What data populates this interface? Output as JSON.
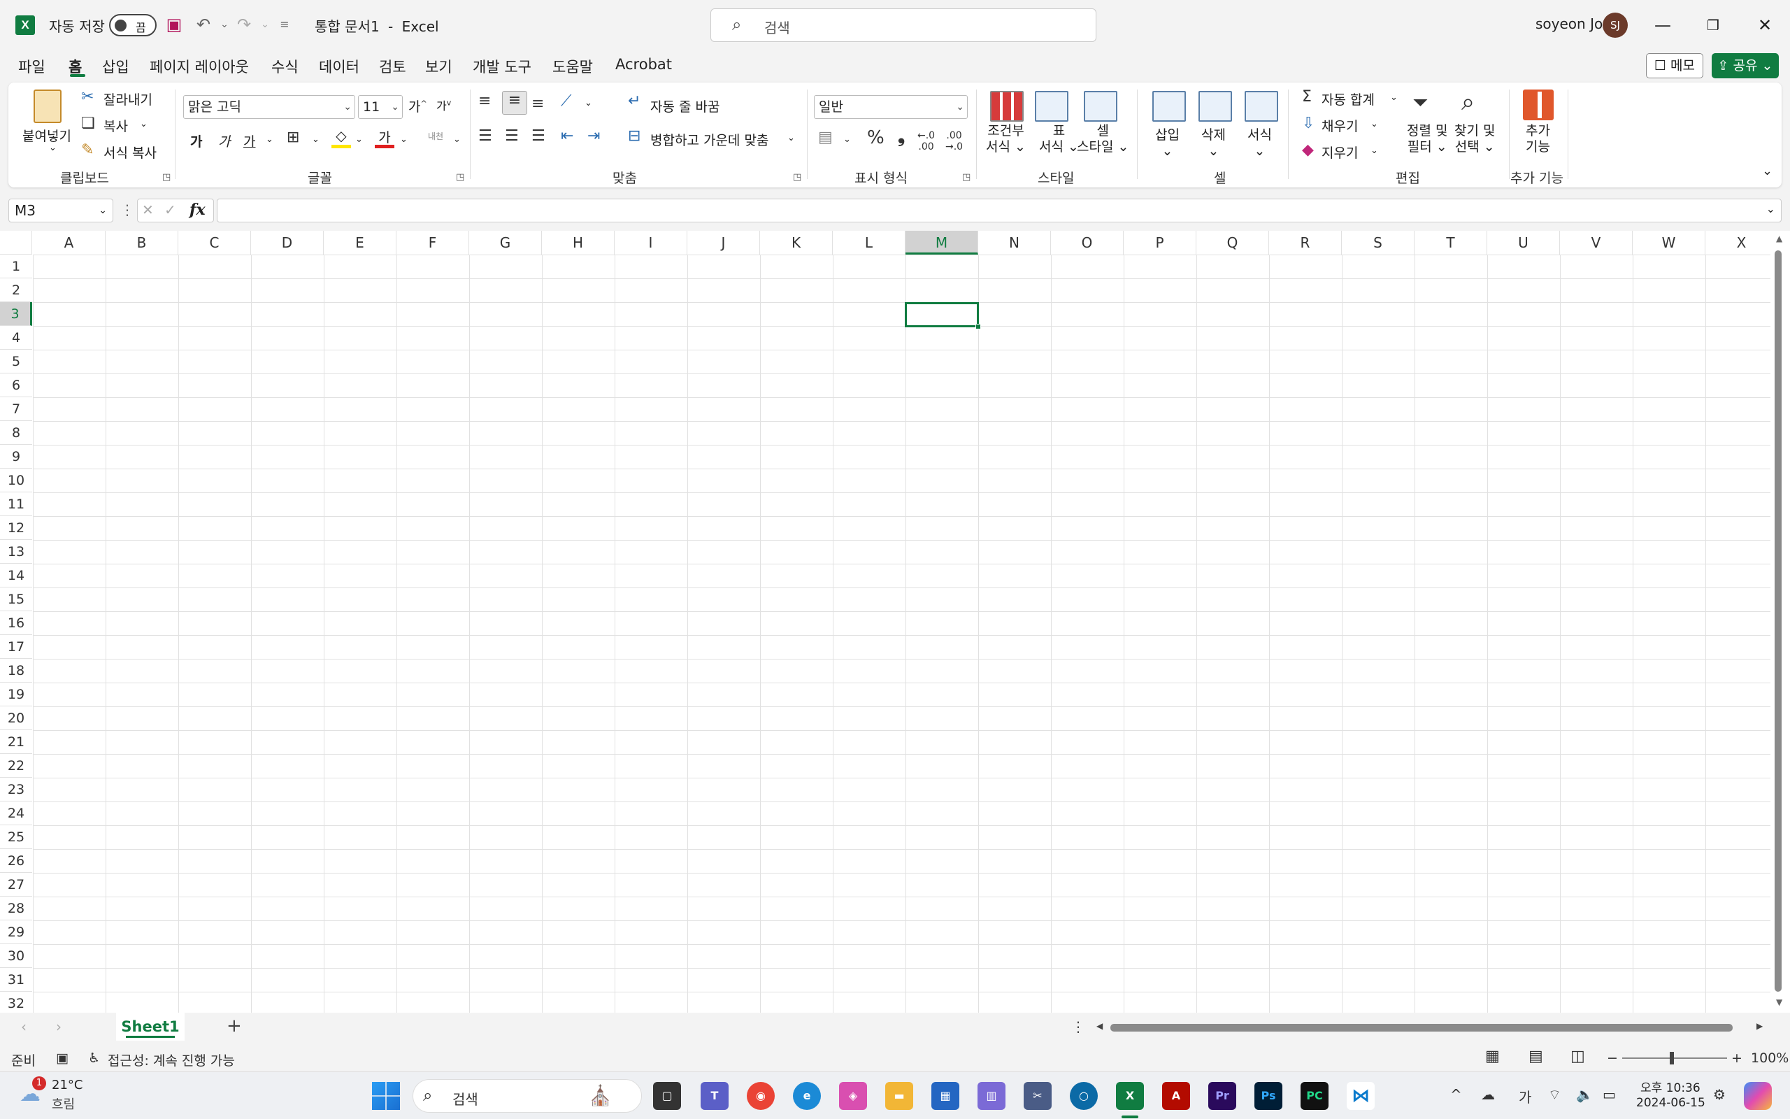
{
  "titlebar": {
    "autosave_label": "자동 저장",
    "autosave_state": "끔",
    "doc_title": "통합 문서1",
    "separator": "-",
    "app_name": "Excel",
    "search_placeholder": "검색",
    "user_name": "soyeon Jo",
    "user_initials": "SJ"
  },
  "menu": {
    "tabs": [
      "파일",
      "홈",
      "삽입",
      "페이지 레이아웃",
      "수식",
      "데이터",
      "검토",
      "보기",
      "개발 도구",
      "도움말",
      "Acrobat"
    ],
    "active_tab": "홈",
    "memo_label": "메모",
    "share_label": "공유"
  },
  "ribbon": {
    "clipboard": {
      "paste": "붙여넣기",
      "cut": "잘라내기",
      "copy": "복사",
      "format_painter": "서식 복사",
      "group": "클립보드"
    },
    "font": {
      "font_name": "맑은 고딕",
      "font_size": "11",
      "bold": "가",
      "italic": "가",
      "underline": "가",
      "group": "글꼴"
    },
    "alignment": {
      "wrap_text": "자동 줄 바꿈",
      "merge_center": "병합하고 가운데 맞춤",
      "group": "맞춤"
    },
    "number": {
      "format": "일반",
      "group": "표시 형식"
    },
    "styles": {
      "conditional": [
        "조건부",
        "서식"
      ],
      "table": [
        "표",
        "서식"
      ],
      "cell": [
        "셀",
        "스타일"
      ],
      "group": "스타일"
    },
    "cells": {
      "insert": "삽입",
      "delete": "삭제",
      "format": "서식",
      "group": "셀"
    },
    "editing": {
      "autosum": "자동 합계",
      "fill": "채우기",
      "clear": "지우기",
      "sort": [
        "정렬 및",
        "필터"
      ],
      "find": [
        "찾기 및",
        "선택"
      ],
      "group": "편집"
    },
    "addins": {
      "label": [
        "추가",
        "기능"
      ],
      "group": "추가 기능"
    }
  },
  "formula": {
    "name_box": "M3",
    "fx": "fx",
    "value": ""
  },
  "grid": {
    "columns": [
      "A",
      "B",
      "C",
      "D",
      "E",
      "F",
      "G",
      "H",
      "I",
      "J",
      "K",
      "L",
      "M",
      "N",
      "O",
      "P",
      "Q",
      "R",
      "S",
      "T",
      "U",
      "V",
      "W",
      "X"
    ],
    "rows": [
      "1",
      "2",
      "3",
      "4",
      "5",
      "6",
      "7",
      "8",
      "9",
      "10",
      "11",
      "12",
      "13",
      "14",
      "15",
      "16",
      "17",
      "18",
      "19",
      "20",
      "21",
      "22",
      "23",
      "24",
      "25",
      "26",
      "27",
      "28",
      "29",
      "30",
      "31",
      "32"
    ],
    "selected_cell": "M3"
  },
  "sheets": {
    "tabs": [
      "Sheet1"
    ],
    "active": "Sheet1"
  },
  "status": {
    "ready": "준비",
    "accessibility": "접근성: 계속 진행 가능",
    "zoom": "100%"
  },
  "taskbar": {
    "weather_temp": "21°C",
    "weather_desc": "흐림",
    "weather_badge": "1",
    "search_placeholder": "검색",
    "ime": "가",
    "time_period": "오후 10:36",
    "date": "2024-06-15"
  },
  "colors": {
    "accent": "#107c41",
    "brand_excel": "#107c41"
  }
}
